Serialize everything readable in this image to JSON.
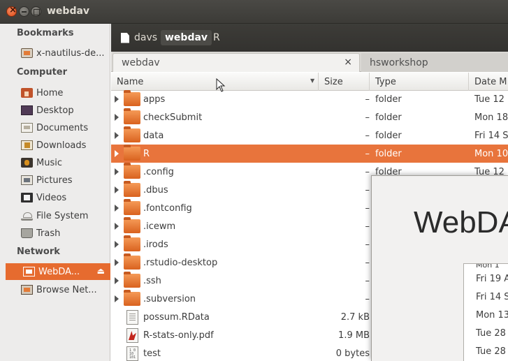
{
  "window": {
    "title": "webdav"
  },
  "sidebar": {
    "sections": [
      {
        "label": "Bookmarks"
      },
      {
        "label": "Computer"
      },
      {
        "label": "Network"
      }
    ],
    "items": [
      {
        "label": "x-nautilus-de...",
        "icon": "drive-icon"
      },
      {
        "label": "Home",
        "icon": "home-folder-icon"
      },
      {
        "label": "Desktop",
        "icon": "desktop-icon"
      },
      {
        "label": "Documents",
        "icon": "documents-icon"
      },
      {
        "label": "Downloads",
        "icon": "downloads-icon"
      },
      {
        "label": "Music",
        "icon": "music-icon"
      },
      {
        "label": "Pictures",
        "icon": "pictures-icon"
      },
      {
        "label": "Videos",
        "icon": "videos-icon"
      },
      {
        "label": "File System",
        "icon": "filesystem-icon"
      },
      {
        "label": "Trash",
        "icon": "trash-icon"
      },
      {
        "label": "WebDA...",
        "icon": "network-drive-icon",
        "active": true
      },
      {
        "label": "Browse Net...",
        "icon": "network-icon"
      }
    ]
  },
  "pathbar": {
    "crumbs": [
      "davs",
      "webdav",
      "R"
    ],
    "current": "webdav"
  },
  "tabs": [
    {
      "label": "webdav",
      "close": "×"
    },
    {
      "label": "hsworkshop"
    }
  ],
  "columns": {
    "name": "Name",
    "size": "Size",
    "type": "Type",
    "date": "Date M"
  },
  "files": [
    {
      "name": "apps",
      "size": "–",
      "type": "folder",
      "date": "Tue 12",
      "kind": "folder"
    },
    {
      "name": "checkSubmit",
      "size": "–",
      "type": "folder",
      "date": "Mon 18",
      "kind": "folder"
    },
    {
      "name": "data",
      "size": "–",
      "type": "folder",
      "date": "Fri 14 S",
      "kind": "folder"
    },
    {
      "name": "R",
      "size": "–",
      "type": "folder",
      "date": "Mon 10",
      "kind": "folder",
      "selected": true
    },
    {
      "name": ".config",
      "size": "–",
      "type": "folder",
      "date": "Tue 12",
      "kind": "folder"
    },
    {
      "name": ".dbus",
      "size": "–",
      "type": "",
      "date": "",
      "kind": "folder"
    },
    {
      "name": ".fontconfig",
      "size": "–",
      "type": "",
      "date": "",
      "kind": "folder"
    },
    {
      "name": ".icewm",
      "size": "–",
      "type": "",
      "date": "",
      "kind": "folder"
    },
    {
      "name": ".irods",
      "size": "–",
      "type": "",
      "date": "",
      "kind": "folder"
    },
    {
      "name": ".rstudio-desktop",
      "size": "–",
      "type": "",
      "date": "",
      "kind": "folder"
    },
    {
      "name": ".ssh",
      "size": "–",
      "type": "",
      "date": "",
      "kind": "folder"
    },
    {
      "name": ".subversion",
      "size": "–",
      "type": "",
      "date": "",
      "kind": "folder"
    },
    {
      "name": "possum.RData",
      "size": "2.7 kB",
      "type": "",
      "date": "",
      "kind": "doc"
    },
    {
      "name": "R-stats-only.pdf",
      "size": "1.9 MB",
      "type": "",
      "date": "",
      "kind": "pdf"
    },
    {
      "name": "test",
      "size": "0 bytes",
      "type": "",
      "date": "",
      "kind": "bin"
    }
  ],
  "overlay": {
    "title": "WebDA",
    "dates": [
      "Mon 1",
      "Fri 19 A",
      "Fri 14 S",
      "Mon 13",
      "Tue 28",
      "Tue 28"
    ]
  }
}
